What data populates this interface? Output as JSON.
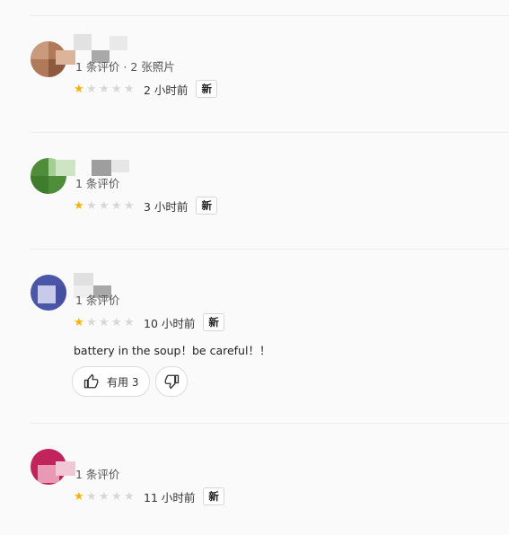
{
  "reviews": [
    {
      "meta": "1 条评价 · 2 张照片",
      "rating": 1,
      "time": "2 小时前",
      "badge": "新",
      "avatar_color": "#b07a5a"
    },
    {
      "meta": "1 条评价",
      "rating": 1,
      "time": "3 小时前",
      "badge": "新",
      "avatar_color": "#4f8d3a"
    },
    {
      "meta": "1 条评价",
      "rating": 1,
      "time": "10 小时前",
      "badge": "新",
      "text": "battery in the soup！be careful！！",
      "helpful_label": "有用 3",
      "avatar_color": "#4c56a8"
    },
    {
      "meta": "1 条评价",
      "rating": 1,
      "time": "11 小时前",
      "badge": "新",
      "avatar_color": "#c0245a"
    }
  ],
  "colors": {
    "star_filled": "#f4b400",
    "star_empty": "#d7d7d7"
  },
  "icons": {
    "thumb_up": "thumbs-up-icon",
    "thumb_down": "thumbs-down-icon"
  }
}
